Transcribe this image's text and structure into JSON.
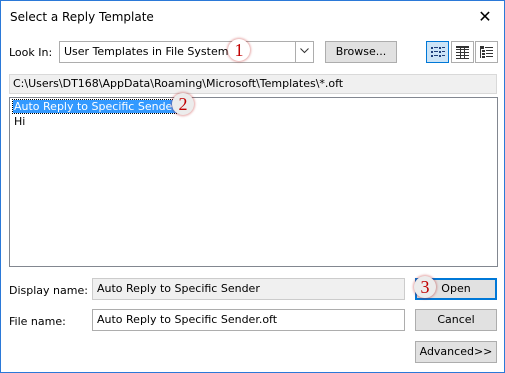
{
  "window": {
    "title": "Select a Reply Template",
    "close_glyph": "✕"
  },
  "look_in": {
    "label": "Look In:",
    "selected": "User Templates in File System",
    "arrow_icon": "chevron-down-icon",
    "browse_label": "Browse..."
  },
  "view_buttons": [
    "list-view-icon",
    "details-view-icon",
    "properties-view-icon"
  ],
  "path": "C:\\Users\\DT168\\AppData\\Roaming\\Microsoft\\Templates\\*.oft",
  "files": [
    "Auto Reply to Specific Sender",
    "Hi"
  ],
  "display_name": {
    "label": "Display name:",
    "value": "Auto Reply to Specific Sender"
  },
  "file_name": {
    "label": "File name:",
    "value": "Auto Reply to Specific Sender.oft"
  },
  "buttons": {
    "open": "Open",
    "cancel": "Cancel",
    "advanced": "Advanced>>"
  },
  "callouts": [
    "1",
    "2",
    "3"
  ],
  "colors": {
    "accent": "#0078d7",
    "selection": "#3399ff",
    "callout": "#c00000"
  }
}
